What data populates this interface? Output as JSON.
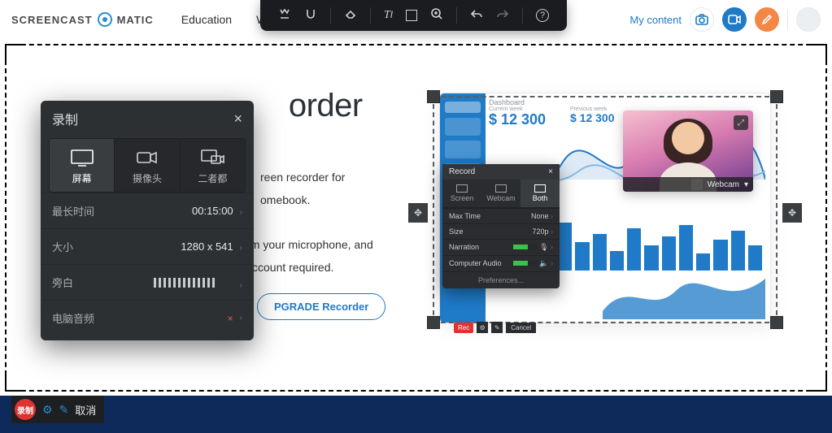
{
  "brand": {
    "left": "SCREENCAST",
    "right": "MATIC"
  },
  "nav": {
    "education": "Education",
    "work": "Wor"
  },
  "topright": {
    "mycontent": "My content"
  },
  "hero": {
    "title_right": "order",
    "p1_right": "reen recorder for",
    "p2_right": "omebook.",
    "p3_right": "om your microphone, and",
    "p4_right": "ccount required.",
    "upgrade": "PGRADE Recorder"
  },
  "rec": {
    "title": "录制",
    "modes": {
      "screen": "屏幕",
      "webcam": "摄像头",
      "both": "二者都"
    },
    "maxtime": {
      "label": "最长时间",
      "value": "00:15:00"
    },
    "size": {
      "label": "大小",
      "value": "1280 x 541"
    },
    "narration": {
      "label": "旁白"
    },
    "audio": {
      "label": "电脑音频"
    }
  },
  "mini": {
    "title": "Record",
    "screen": "Screen",
    "webcam": "Webcam",
    "both": "Both",
    "maxtime": {
      "label": "Max Time",
      "value": "None"
    },
    "size": {
      "label": "Size",
      "value": "720p"
    },
    "narration": "Narration",
    "caudio": "Computer Audio",
    "prefs": "Preferences...",
    "rec": "Rec",
    "cancel": "Cancel"
  },
  "preview": {
    "dash": "Dashboard",
    "cur": "Current week",
    "prev": "Previous week",
    "big": "$ 12 300",
    "big2": "$ 12 300"
  },
  "webcam": {
    "label": "Webcam",
    "chev": "▾"
  },
  "bottom": {
    "rec": "录制",
    "cancel": "取消"
  }
}
